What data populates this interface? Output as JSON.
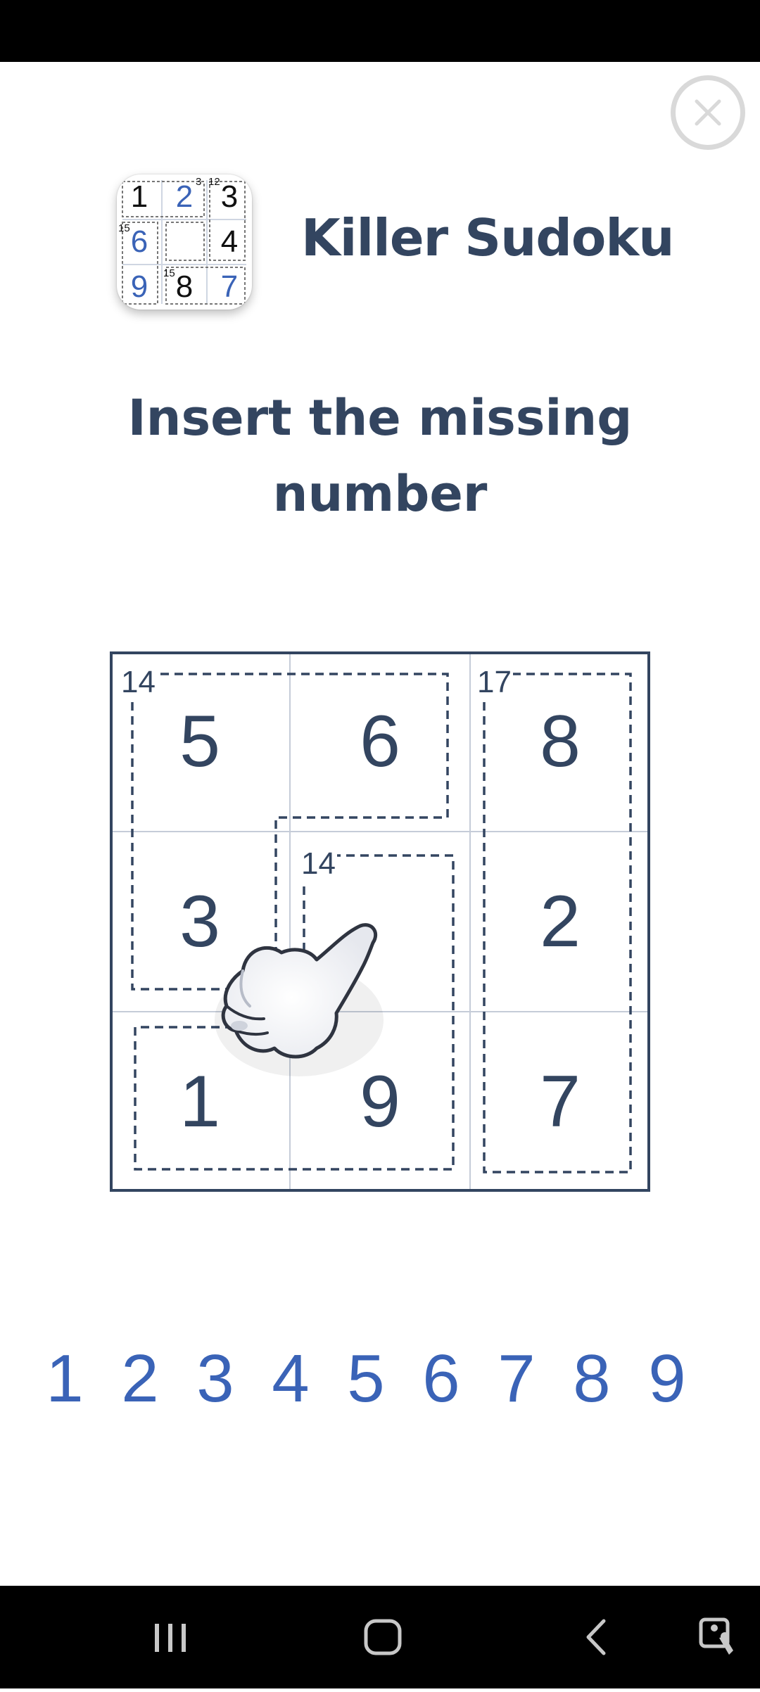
{
  "app": {
    "name": "Killer Sudoku",
    "icon": {
      "cells": [
        "1",
        "2",
        "3",
        "6",
        "",
        "4",
        "9",
        "8",
        "7"
      ],
      "cage_sums": [
        "3",
        "12",
        "15",
        "15"
      ]
    }
  },
  "instruction": "Insert the missing number",
  "board": {
    "cells": [
      "5",
      "6",
      "8",
      "3",
      "",
      "2",
      "1",
      "9",
      "7"
    ],
    "cage_sums": [
      "14",
      "17",
      "14"
    ]
  },
  "numpad": {
    "digits": [
      "1",
      "2",
      "3",
      "4",
      "5",
      "6",
      "7",
      "8",
      "9"
    ]
  },
  "colors": {
    "accent": "#3a63b7",
    "text_dark": "#334560",
    "close_ring": "#d9d9d9"
  },
  "icons": {
    "close": "close-icon",
    "pointer": "pointing-hand-icon",
    "nav": [
      "game-launcher-icon",
      "recent-apps-icon",
      "home-icon",
      "back-icon",
      "accessibility-icon"
    ]
  }
}
